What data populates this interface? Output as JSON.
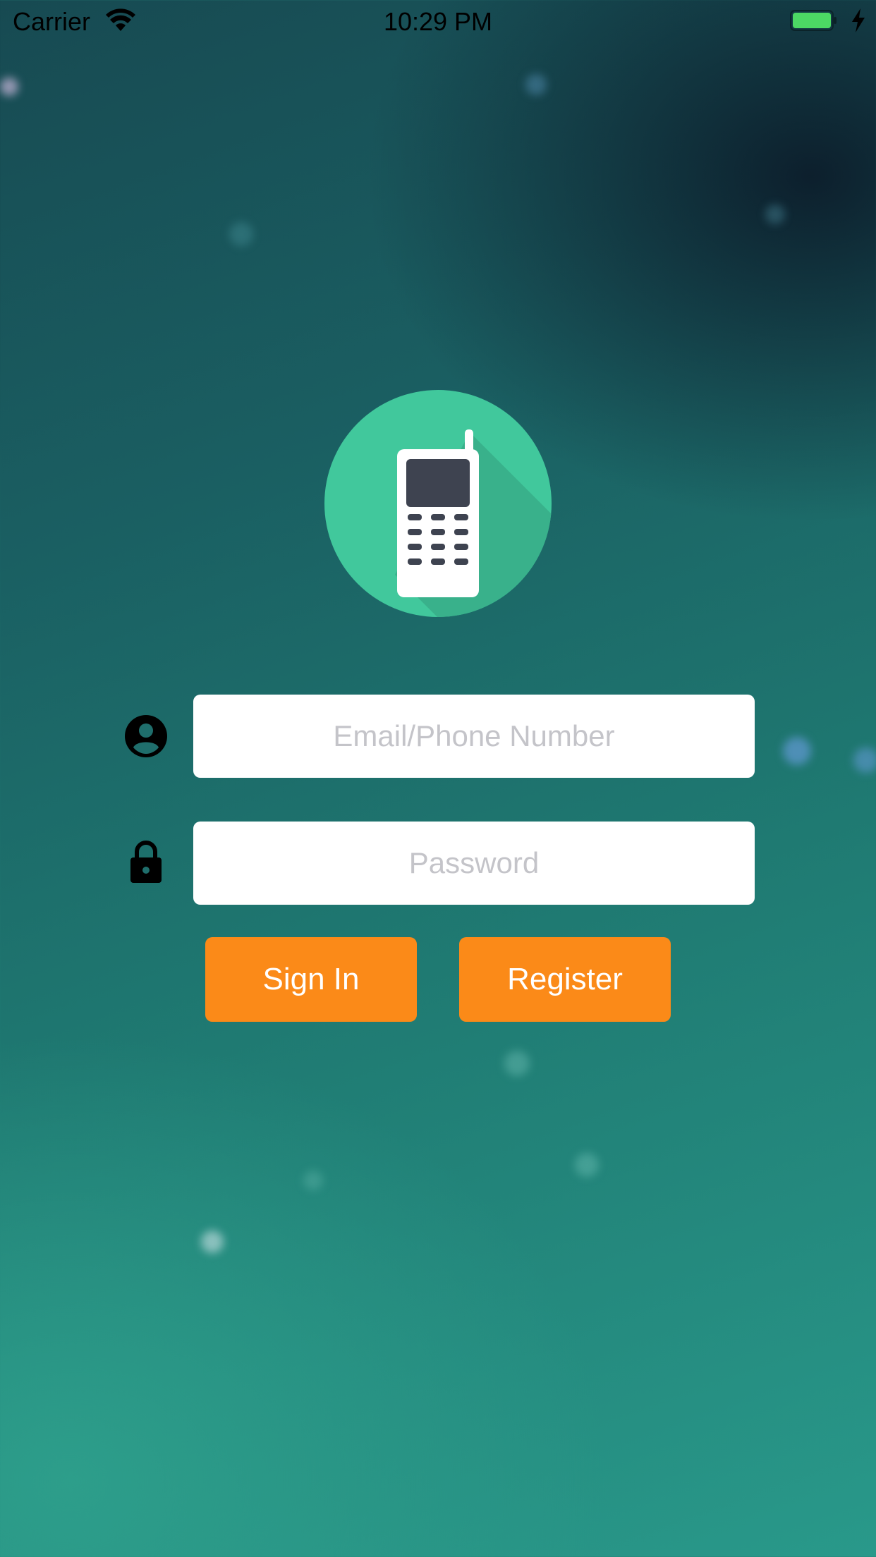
{
  "status_bar": {
    "carrier": "Carrier",
    "time": "10:29 PM",
    "battery_color": "#4cd964",
    "icons": [
      "wifi-icon",
      "battery-icon",
      "charging-icon"
    ]
  },
  "logo": {
    "icon": "mobile-phone-icon",
    "circle_color": "#41c89c",
    "phone_color": "#ffffff",
    "screen_color": "#3e4350"
  },
  "login_form": {
    "username": {
      "icon": "user-icon",
      "value": "",
      "placeholder": "Email/Phone Number"
    },
    "password": {
      "icon": "lock-icon",
      "value": "",
      "placeholder": "Password"
    }
  },
  "actions": {
    "sign_in_label": "Sign In",
    "register_label": "Register",
    "button_color": "#fb8a18"
  }
}
